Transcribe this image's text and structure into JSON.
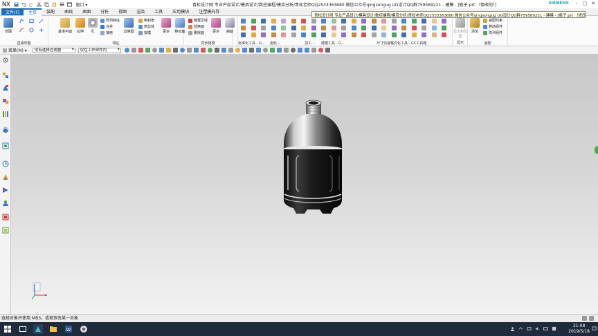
{
  "titlebar": {
    "logo": "NX",
    "window_menu": "窗口 ▾",
    "title": "青松设计网 专业产品设计/模具设计/数控编程/模流分析/青松老师QQ2533363680 微信公众号qingsongug UG设计QQ群759589221 - 建模 - [瓶子.prt （修改的）]",
    "brand": "SIEMENS"
  },
  "tooltip": "青松设计网 专业产品设计/模具设计/数控编程/模流分析/青松老师QQ2533363680 微信公众号qingsongug UG设计QQ群759589221 - 建模 - [瓶子.prt （修改的）]",
  "tabs": {
    "file": "文件(F)",
    "items": [
      "主页",
      "装配",
      "曲线",
      "曲面",
      "分析",
      "视图",
      "渲染",
      "工具",
      "应用模块",
      "注塑模向导"
    ]
  },
  "ribbon": {
    "sketch": "草图",
    "sketch_group": "直接草图",
    "datum": "基准平面",
    "extrude": "拉伸",
    "hole": "孔",
    "pattern": "阵列特征",
    "unite": "合并",
    "shell": "抽壳",
    "edge_blend": "边倒圆",
    "chamfer": "倒斜角",
    "trim": "修剪体",
    "draft": "拔模",
    "feature_group": "特征",
    "more": "更多",
    "move_face": "移动面",
    "offset_region": "偏置区域",
    "replace_face": "替换面",
    "delete_face": "删除面",
    "sync_group": "同步建模",
    "surface": "曲面",
    "more2": "更多",
    "std_tools": "标准化工具 - G...",
    "gear": "齿轮...",
    "process": "加工...",
    "building": "建模工具 - G...",
    "dimension_group": "尺寸快速格式化工具 - GC工具箱",
    "display_group": "显示",
    "hide_show": "显示和隐藏",
    "add": "添加",
    "assembly_constraint": "装配约束",
    "move_component": "移动组件",
    "array_component": "阵列组件",
    "assembly_group": "装配"
  },
  "seltoolbar": {
    "menu": "菜单(M) ▾",
    "filter": "没有选择过滤器",
    "scope": "仅在工作部件内"
  },
  "statusbar": {
    "prompt": "选择对象并使用 MB3，或者双击某一对象"
  },
  "taskbar": {
    "time": "21:08",
    "date": "2019/5/18"
  },
  "colors": {
    "accent": "#1e6fb5",
    "taskbar": "#1f2a3a",
    "brand": "#009999"
  }
}
